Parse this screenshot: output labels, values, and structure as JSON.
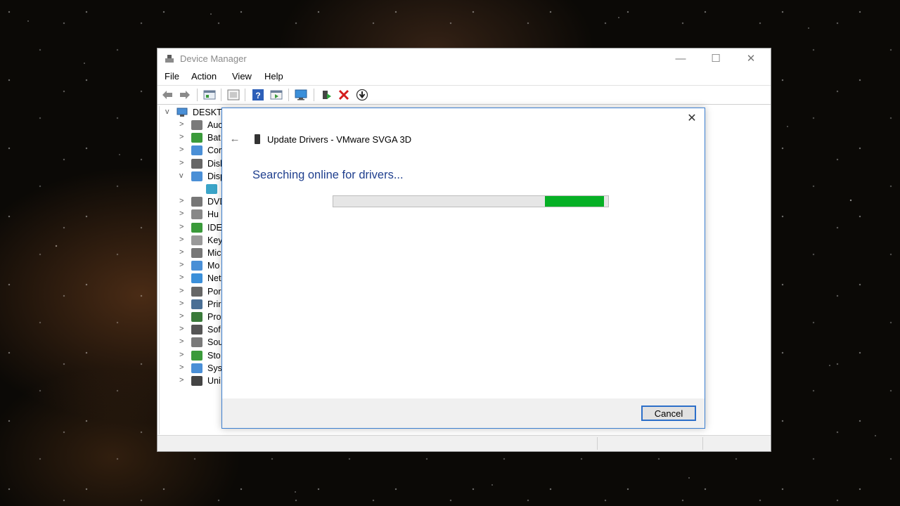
{
  "window": {
    "title": "Device Manager",
    "controls": {
      "minimize": "—",
      "maximize": "☐",
      "close": "✕"
    }
  },
  "menu": {
    "items": [
      "File",
      "Action",
      "View",
      "Help"
    ]
  },
  "toolbar": {
    "icons": [
      "back-arrow-icon",
      "forward-arrow-icon",
      "properties-icon",
      "show-hidden-icon",
      "help-icon",
      "run-icon",
      "monitor-icon",
      "update-driver-icon",
      "uninstall-icon",
      "scan-download-icon"
    ]
  },
  "tree": {
    "root": "DESKTC",
    "items": [
      {
        "label": "Auc",
        "expander": ">",
        "icon": "audio-icon"
      },
      {
        "label": "Bat",
        "expander": ">",
        "icon": "battery-icon"
      },
      {
        "label": "Cor",
        "expander": ">",
        "icon": "computer-icon"
      },
      {
        "label": "Disl",
        "expander": ">",
        "icon": "disk-icon"
      },
      {
        "label": "Disp",
        "expander": "v",
        "icon": "display-icon"
      },
      {
        "label": "",
        "expander": "",
        "icon": "display-adapter-icon"
      },
      {
        "label": "DVD",
        "expander": ">",
        "icon": "dvd-icon"
      },
      {
        "label": "Hu",
        "expander": ">",
        "icon": "hid-icon"
      },
      {
        "label": "IDE",
        "expander": ">",
        "icon": "ide-icon"
      },
      {
        "label": "Key",
        "expander": ">",
        "icon": "keyboard-icon"
      },
      {
        "label": "Mic",
        "expander": ">",
        "icon": "mouse-icon"
      },
      {
        "label": "Mo",
        "expander": ">",
        "icon": "monitor-icon"
      },
      {
        "label": "Net",
        "expander": ">",
        "icon": "network-icon"
      },
      {
        "label": "Por",
        "expander": ">",
        "icon": "port-icon"
      },
      {
        "label": "Prir",
        "expander": ">",
        "icon": "printer-icon"
      },
      {
        "label": "Pro",
        "expander": ">",
        "icon": "processor-icon"
      },
      {
        "label": "Sof",
        "expander": ">",
        "icon": "software-icon"
      },
      {
        "label": "Sou",
        "expander": ">",
        "icon": "sound-icon"
      },
      {
        "label": "Sto",
        "expander": ">",
        "icon": "storage-icon"
      },
      {
        "label": "Sys",
        "expander": ">",
        "icon": "system-icon"
      },
      {
        "label": "Uni",
        "expander": ">",
        "icon": "usb-icon"
      }
    ]
  },
  "dialog": {
    "close": "✕",
    "back": "←",
    "title": "Update Drivers - VMware SVGA 3D",
    "heading": "Searching online for drivers...",
    "progress_fraction": 0.79,
    "cancel_label": "Cancel"
  },
  "colors": {
    "accent_blue": "#1f3f8e",
    "progress_green": "#06b025",
    "dialog_border": "#3c7fd0"
  }
}
